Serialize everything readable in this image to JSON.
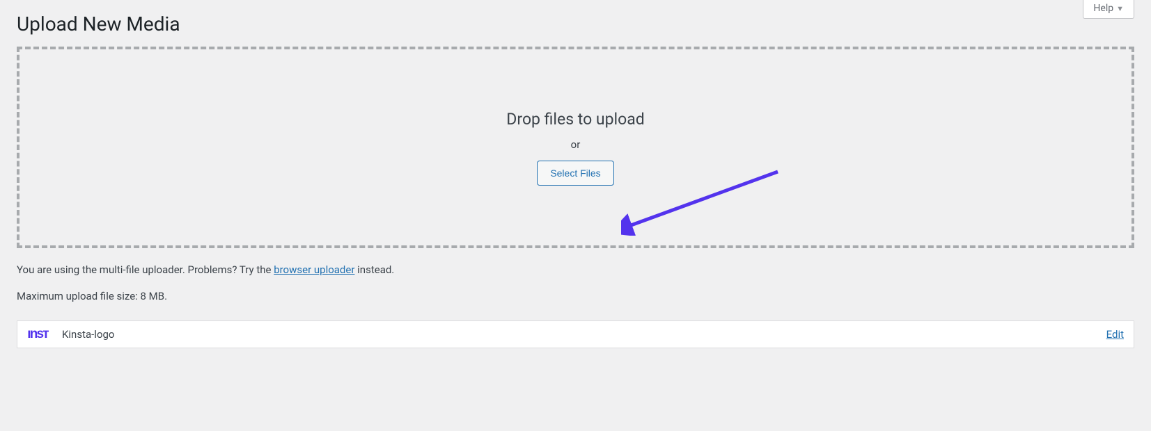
{
  "help_tab_label": "Help",
  "page_title": "Upload New Media",
  "dropzone": {
    "prompt": "Drop files to upload",
    "or": "or",
    "button_label": "Select Files"
  },
  "upload_info": {
    "prefix_text": "You are using the multi-file uploader. Problems? Try the ",
    "link_text": "browser uploader",
    "suffix_text": " instead."
  },
  "max_size_text": "Maximum upload file size: 8 MB.",
  "media_item": {
    "thumb_text": "ınsᴛ",
    "filename": "Kinsta-logo",
    "edit_label": "Edit"
  }
}
